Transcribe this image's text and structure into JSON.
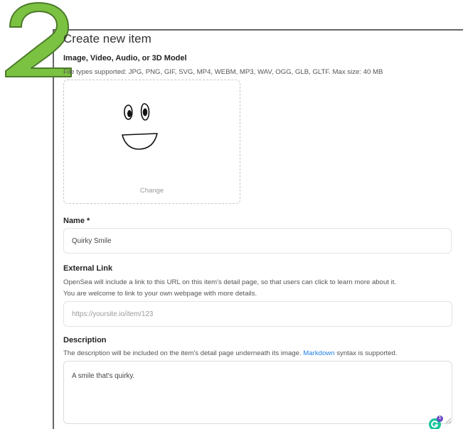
{
  "step": {
    "number": "2",
    "color": "#7cc242",
    "outline": "#4c7a2a"
  },
  "page": {
    "title": "Create new item"
  },
  "media": {
    "heading": "Image, Video, Audio, or 3D Model",
    "help": "File types supported: JPG, PNG, GIF, SVG, MP4, WEBM, MP3, WAV, OGG, GLB, GLTF. Max size: 40 MB",
    "change_label": "Change"
  },
  "name_field": {
    "label": "Name *",
    "value": "Quirky Smile"
  },
  "external_link": {
    "label": "External Link",
    "help_line1": "OpenSea will include a link to this URL on this item's detail page, so that users can click to learn more about it.",
    "help_line2": "You are welcome to link to your own webpage with more details.",
    "placeholder": "https://yoursite.io/item/123"
  },
  "description": {
    "label": "Description",
    "help_before": "The description will be included on the item's detail page underneath its image.",
    "help_link": "Markdown",
    "help_after": "syntax is supported.",
    "value": "A smile that's quirky."
  },
  "grammarly": {
    "icon": "grammarly-icon",
    "badge_count": "1",
    "color": "#15c39a"
  },
  "colors": {
    "link": "#2081e2",
    "frame": "#666666"
  }
}
